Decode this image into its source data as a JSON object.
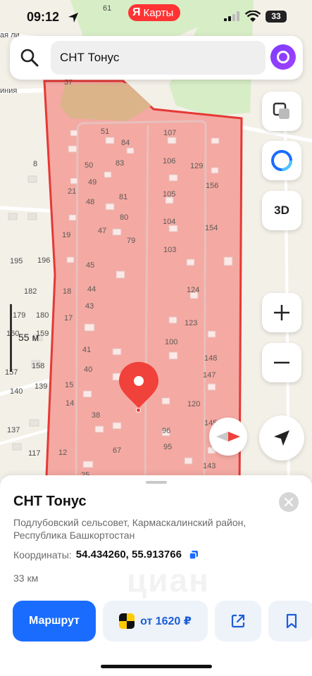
{
  "status_bar": {
    "time": "09:12",
    "brand_logo": "Я",
    "brand_name": "Карты",
    "battery": "33",
    "icons": [
      "location-arrow-icon",
      "signal-icon",
      "wifi-icon",
      "battery-icon"
    ]
  },
  "search": {
    "query": "СНТ Тонус",
    "icons": [
      "search-icon",
      "alice-icon"
    ]
  },
  "map": {
    "scale_label": "55 м",
    "buttons": {
      "layers": "layers-icon",
      "alice": "alice-icon",
      "view_3d": "3D",
      "zoom_in": "+",
      "zoom_out": "−"
    },
    "street_fragments": [
      "ая ли",
      "иния"
    ],
    "plot_numbers": [
      "61",
      "37",
      "51",
      "84",
      "107",
      "50",
      "83",
      "106",
      "129",
      "8",
      "49",
      "21",
      "156",
      "48",
      "81",
      "105",
      "47",
      "80",
      "104",
      "154",
      "19",
      "79",
      "103",
      "195",
      "196",
      "45",
      "182",
      "18",
      "44",
      "124",
      "179",
      "180",
      "43",
      "17",
      "123",
      "160",
      "159",
      "41",
      "100",
      "158",
      "40",
      "148",
      "157",
      "139",
      "147",
      "15",
      "140",
      "14",
      "120",
      "38",
      "137",
      "96",
      "145",
      "117",
      "12",
      "67",
      "95",
      "143",
      "25",
      "14"
    ],
    "accent_colors": {
      "area_fill": "#f4a9a3",
      "area_border": "#e53935",
      "pin": "#f0413b"
    }
  },
  "sheet": {
    "title": "СНТ Тонус",
    "address": "Подлубовский сельсовет, Кармаскалинский район, Республика Башкортостан",
    "coords_label": "Координаты:",
    "coords_value": "54.434260, 55.913766",
    "distance": "33 км",
    "route_button": "Маршрут",
    "taxi_button": "от 1620 ₽",
    "watermark": "циан",
    "icons": [
      "close-icon",
      "copy-icon",
      "taxi-icon",
      "share-icon",
      "bookmark-icon"
    ]
  },
  "colors": {
    "accent": "#1a6cff",
    "title": "#111111",
    "muted": "#6b6b6b"
  }
}
